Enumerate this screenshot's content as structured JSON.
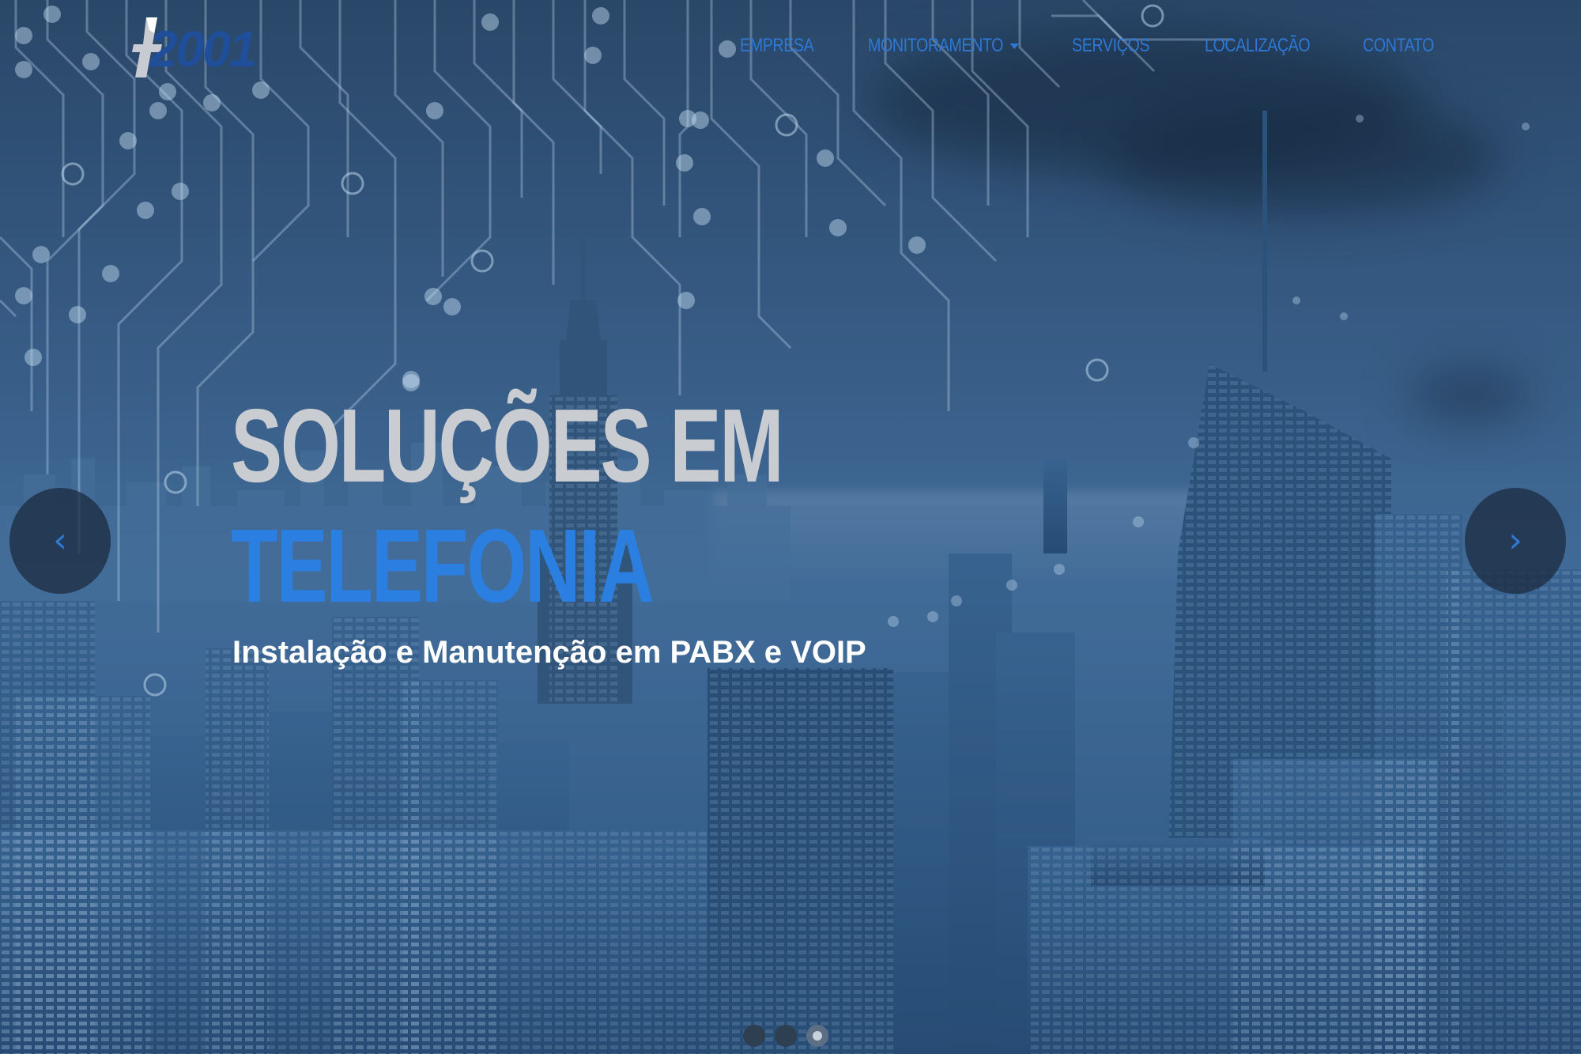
{
  "logo": {
    "text": "2001"
  },
  "nav": {
    "items": [
      {
        "label": "EMPRESA"
      },
      {
        "label": "MONITORAMENTO",
        "has_dropdown": true
      },
      {
        "label": "SERVIÇOS"
      },
      {
        "label": "LOCALIZAÇÃO"
      },
      {
        "label": "CONTATO"
      }
    ]
  },
  "hero": {
    "headline_line1": "SOLUÇÕES EM",
    "headline_line2": "TELEFONIA",
    "subtitle": "Instalação e Manutenção em PABX e VOIP"
  },
  "carousel": {
    "prev_icon": "‹",
    "next_icon": "›",
    "slide_count": 3,
    "active_slide": 3
  },
  "colors": {
    "accent": "#2b7fe0",
    "nav_text": "#2f78d4",
    "headline_gray": "#c9ccd1",
    "overlay_blue": "#3c6896"
  }
}
